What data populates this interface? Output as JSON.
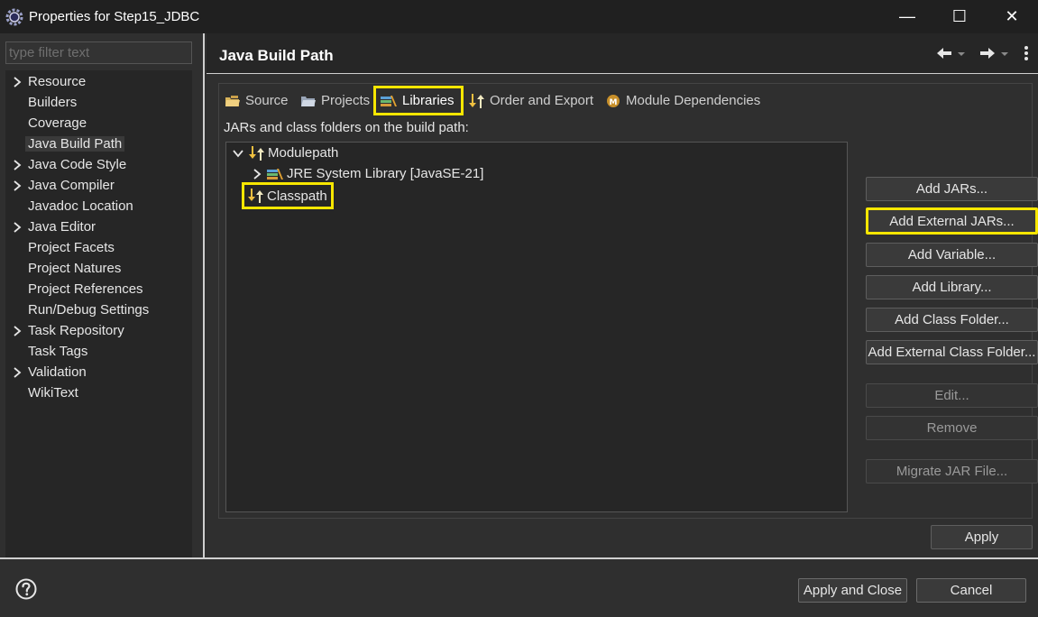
{
  "window": {
    "title": "Properties for Step15_JDBC",
    "minimize_glyph": "—",
    "maximize_glyph": "☐",
    "close_glyph": "✕"
  },
  "filter": {
    "placeholder": "type filter text",
    "value": ""
  },
  "nav_items": [
    {
      "label": "Resource",
      "expandable": true
    },
    {
      "label": "Builders",
      "expandable": false
    },
    {
      "label": "Coverage",
      "expandable": false
    },
    {
      "label": "Java Build Path",
      "expandable": false,
      "selected": true
    },
    {
      "label": "Java Code Style",
      "expandable": true
    },
    {
      "label": "Java Compiler",
      "expandable": true
    },
    {
      "label": "Javadoc Location",
      "expandable": false
    },
    {
      "label": "Java Editor",
      "expandable": true
    },
    {
      "label": "Project Facets",
      "expandable": false
    },
    {
      "label": "Project Natures",
      "expandable": false
    },
    {
      "label": "Project References",
      "expandable": false
    },
    {
      "label": "Run/Debug Settings",
      "expandable": false
    },
    {
      "label": "Task Repository",
      "expandable": true
    },
    {
      "label": "Task Tags",
      "expandable": false
    },
    {
      "label": "Validation",
      "expandable": true
    },
    {
      "label": "WikiText",
      "expandable": false
    }
  ],
  "page": {
    "title": "Java Build Path"
  },
  "tabs": [
    {
      "label": "Source"
    },
    {
      "label": "Projects"
    },
    {
      "label": "Libraries",
      "active": true
    },
    {
      "label": "Order and Export"
    },
    {
      "label": "Module Dependencies"
    }
  ],
  "libraries": {
    "description": "JARs and class folders on the build path:",
    "tree": {
      "modulepath": "Modulepath",
      "jre": "JRE System Library [JavaSE-21]",
      "classpath": "Classpath"
    }
  },
  "buttons": {
    "add_jars": "Add JARs...",
    "add_external_jars": "Add External JARs...",
    "add_variable": "Add Variable...",
    "add_library": "Add Library...",
    "add_class_folder": "Add Class Folder...",
    "add_external_class_folder": "Add External Class Folder...",
    "edit": "Edit...",
    "remove": "Remove",
    "migrate_jar": "Migrate JAR File...",
    "apply": "Apply",
    "apply_and_close": "Apply and Close",
    "cancel": "Cancel"
  },
  "colors": {
    "highlight": "#f7e600",
    "background": "#2f2f2f",
    "panel": "#262626"
  }
}
